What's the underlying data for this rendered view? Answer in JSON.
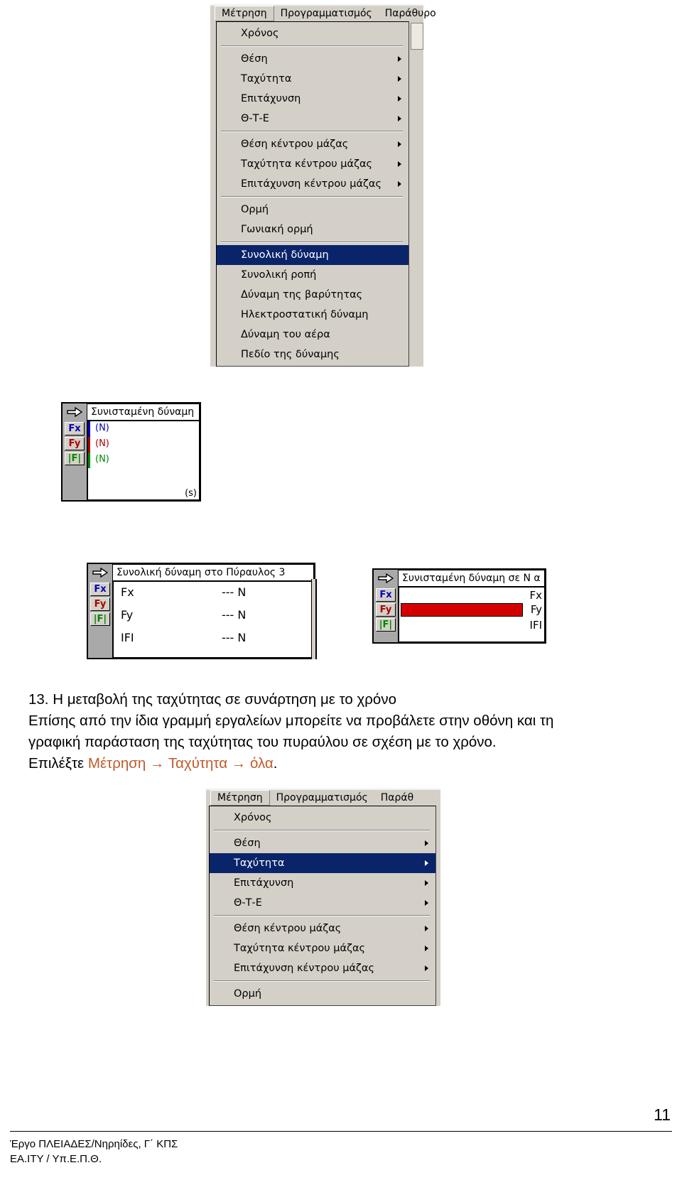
{
  "menubar": {
    "items": [
      {
        "label": "Μέτρηση",
        "accel": "Μ"
      },
      {
        "label": "Προγραμματισμός",
        "accel": "γ"
      },
      {
        "label": "Παράθυρο",
        "accel": "Π"
      }
    ],
    "items_short": [
      {
        "label": "Μέτρηση",
        "accel": "Μ"
      },
      {
        "label": "Προγραμματισμός",
        "accel": "γ"
      },
      {
        "label": "Παράθ",
        "accel": "Π"
      }
    ]
  },
  "menu_top": {
    "groups": [
      [
        {
          "label": "Χρόνος",
          "submenu": false,
          "selected": false
        }
      ],
      [
        {
          "label": "Θέση",
          "submenu": true,
          "selected": false
        },
        {
          "label": "Ταχύτητα",
          "submenu": true,
          "selected": false
        },
        {
          "label": "Επιτάχυνση",
          "submenu": true,
          "selected": false
        },
        {
          "label": "Θ-Τ-Ε",
          "submenu": true,
          "selected": false
        }
      ],
      [
        {
          "label": "Θέση κέντρου μάζας",
          "submenu": true,
          "selected": false
        },
        {
          "label": "Ταχύτητα κέντρου μάζας",
          "submenu": true,
          "selected": false
        },
        {
          "label": "Επιτάχυνση κέντρου μάζας",
          "submenu": true,
          "selected": false
        }
      ],
      [
        {
          "label": "Ορμή",
          "submenu": false,
          "selected": false
        },
        {
          "label": "Γωνιακή ορμή",
          "submenu": false,
          "selected": false
        }
      ],
      [
        {
          "label": "Συνολική δύναμη",
          "submenu": false,
          "selected": true
        },
        {
          "label": "Συνολική ροπή",
          "submenu": false,
          "selected": false
        },
        {
          "label": "Δύναμη της βαρύτητας",
          "submenu": false,
          "selected": false
        },
        {
          "label": "Ηλεκτροστατική δύναμη",
          "submenu": false,
          "selected": false
        },
        {
          "label": "Δύναμη του αέρα",
          "submenu": false,
          "selected": false
        },
        {
          "label": "Πεδίο της δύναμης",
          "submenu": false,
          "selected": false
        }
      ]
    ]
  },
  "menu_bottom": {
    "groups": [
      [
        {
          "label": "Χρόνος",
          "submenu": false,
          "selected": false
        }
      ],
      [
        {
          "label": "Θέση",
          "submenu": true,
          "selected": false
        },
        {
          "label": "Ταχύτητα",
          "submenu": true,
          "selected": true
        },
        {
          "label": "Επιτάχυνση",
          "submenu": true,
          "selected": false
        },
        {
          "label": "Θ-Τ-Ε",
          "submenu": true,
          "selected": false
        }
      ],
      [
        {
          "label": "Θέση κέντρου μάζας",
          "submenu": true,
          "selected": false
        },
        {
          "label": "Ταχύτητα κέντρου μάζας",
          "submenu": true,
          "selected": false
        },
        {
          "label": "Επιτάχυνση κέντρου μάζας",
          "submenu": true,
          "selected": false
        }
      ],
      [
        {
          "label": "Ορμή",
          "submenu": false,
          "selected": false
        }
      ]
    ]
  },
  "meter_small": {
    "title": "Συνισταμένη δύναμη",
    "chips": [
      "Fx",
      "Fy",
      "|F|"
    ],
    "rows": [
      {
        "value": "(N)",
        "color": "#0000bb"
      },
      {
        "value": "(N)",
        "color": "#aa0000"
      },
      {
        "value": "(N)",
        "color": "#008800"
      }
    ],
    "time_unit": "(s)"
  },
  "meter_left": {
    "title": "Συνολική δύναμη στο Πύραυλος 3",
    "chips": [
      "Fx",
      "Fy",
      "|F|"
    ],
    "rows": [
      {
        "name": "Fx",
        "value": "--- N"
      },
      {
        "name": "Fy",
        "value": "--- N"
      },
      {
        "name": "IFI",
        "value": "--- N"
      }
    ]
  },
  "meter_right": {
    "title": "Συνισταμένη δύναμη σε N α",
    "chips": [
      "Fx",
      "Fy",
      "|F|"
    ],
    "bar_labels": [
      "Fx",
      "Fy",
      "IFI"
    ],
    "bar_color": "#d40000"
  },
  "text": {
    "heading": "13. Η μεταβολή της ταχύτητας σε συνάρτηση με το χρόνο",
    "line2": "Επίσης από την ίδια γραμμή εργαλείων μπορείτε να προβάλετε στην οθόνη και τη",
    "line3": "γραφική  παράσταση  της  ταχύτητας  του  πυραύλου  σε  σχέση  με  το  χρόνο.",
    "line4_prefix": "Επιλέξτε ",
    "line4_accent": "Μέτρηση → Ταχύτητα → όλα",
    "line4_suffix": "."
  },
  "footer": {
    "line1": "Έργο ΠΛΕΙΑΔΕΣ/Νηρηίδες, Γ΄ ΚΠΣ",
    "line2": "ΕΑ.ΙΤΥ / Υπ.Ε.Π.Θ.",
    "page_number": "11"
  },
  "colors": {
    "menu_face": "#d4d0c8",
    "selection": "#0a246a",
    "accent_text": "#c05a28",
    "bar_red": "#d40000"
  }
}
